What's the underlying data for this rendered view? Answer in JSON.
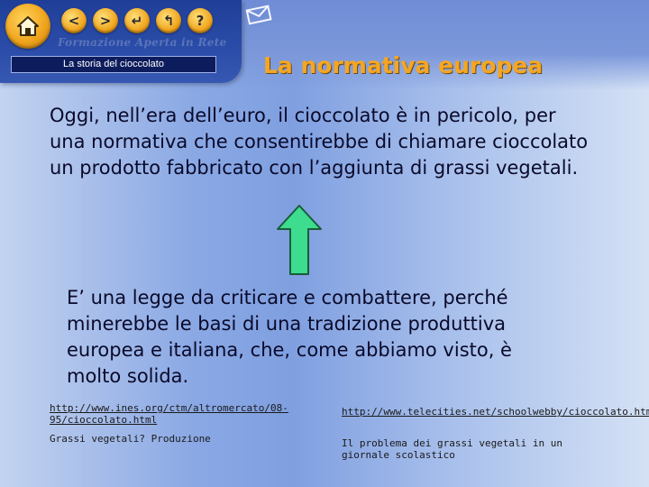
{
  "nav": {
    "buttons": [
      {
        "name": "back",
        "glyph": "<"
      },
      {
        "name": "forward",
        "glyph": ">"
      },
      {
        "name": "return",
        "glyph": "↵"
      },
      {
        "name": "up",
        "glyph": "↰"
      },
      {
        "name": "help",
        "glyph": "?"
      }
    ],
    "brand": "Formazione Aperta in Rete",
    "section_label": "La storia del cioccolato"
  },
  "page": {
    "title": "La normativa europea",
    "paragraph1": "Oggi, nell’era dell’euro, il cioccolato è in pericolo, per una normativa che consentirebbe di chiamare cioccolato un prodotto fabbricato con l’aggiunta di grassi vegetali.",
    "paragraph2": "E’ una legge da criticare e combattere, perché minerebbe le basi di una tradizione produttiva europea e italiana, che, come abbiamo visto, è molto solida."
  },
  "links": {
    "link1": "http://www.ines.org/ctm/altromercato/08-95/cioccolato.html",
    "note1": "Grassi vegetali? Produzione",
    "link2": "http://www.telecities.net/schoolwebby/cioccolato.htm",
    "note2": "Il problema dei grassi vegetali in un giornale scolastico"
  },
  "colors": {
    "title": "#f5a623",
    "arrow_fill": "#3ddc8e",
    "nav_panel": "#1f3e97"
  }
}
